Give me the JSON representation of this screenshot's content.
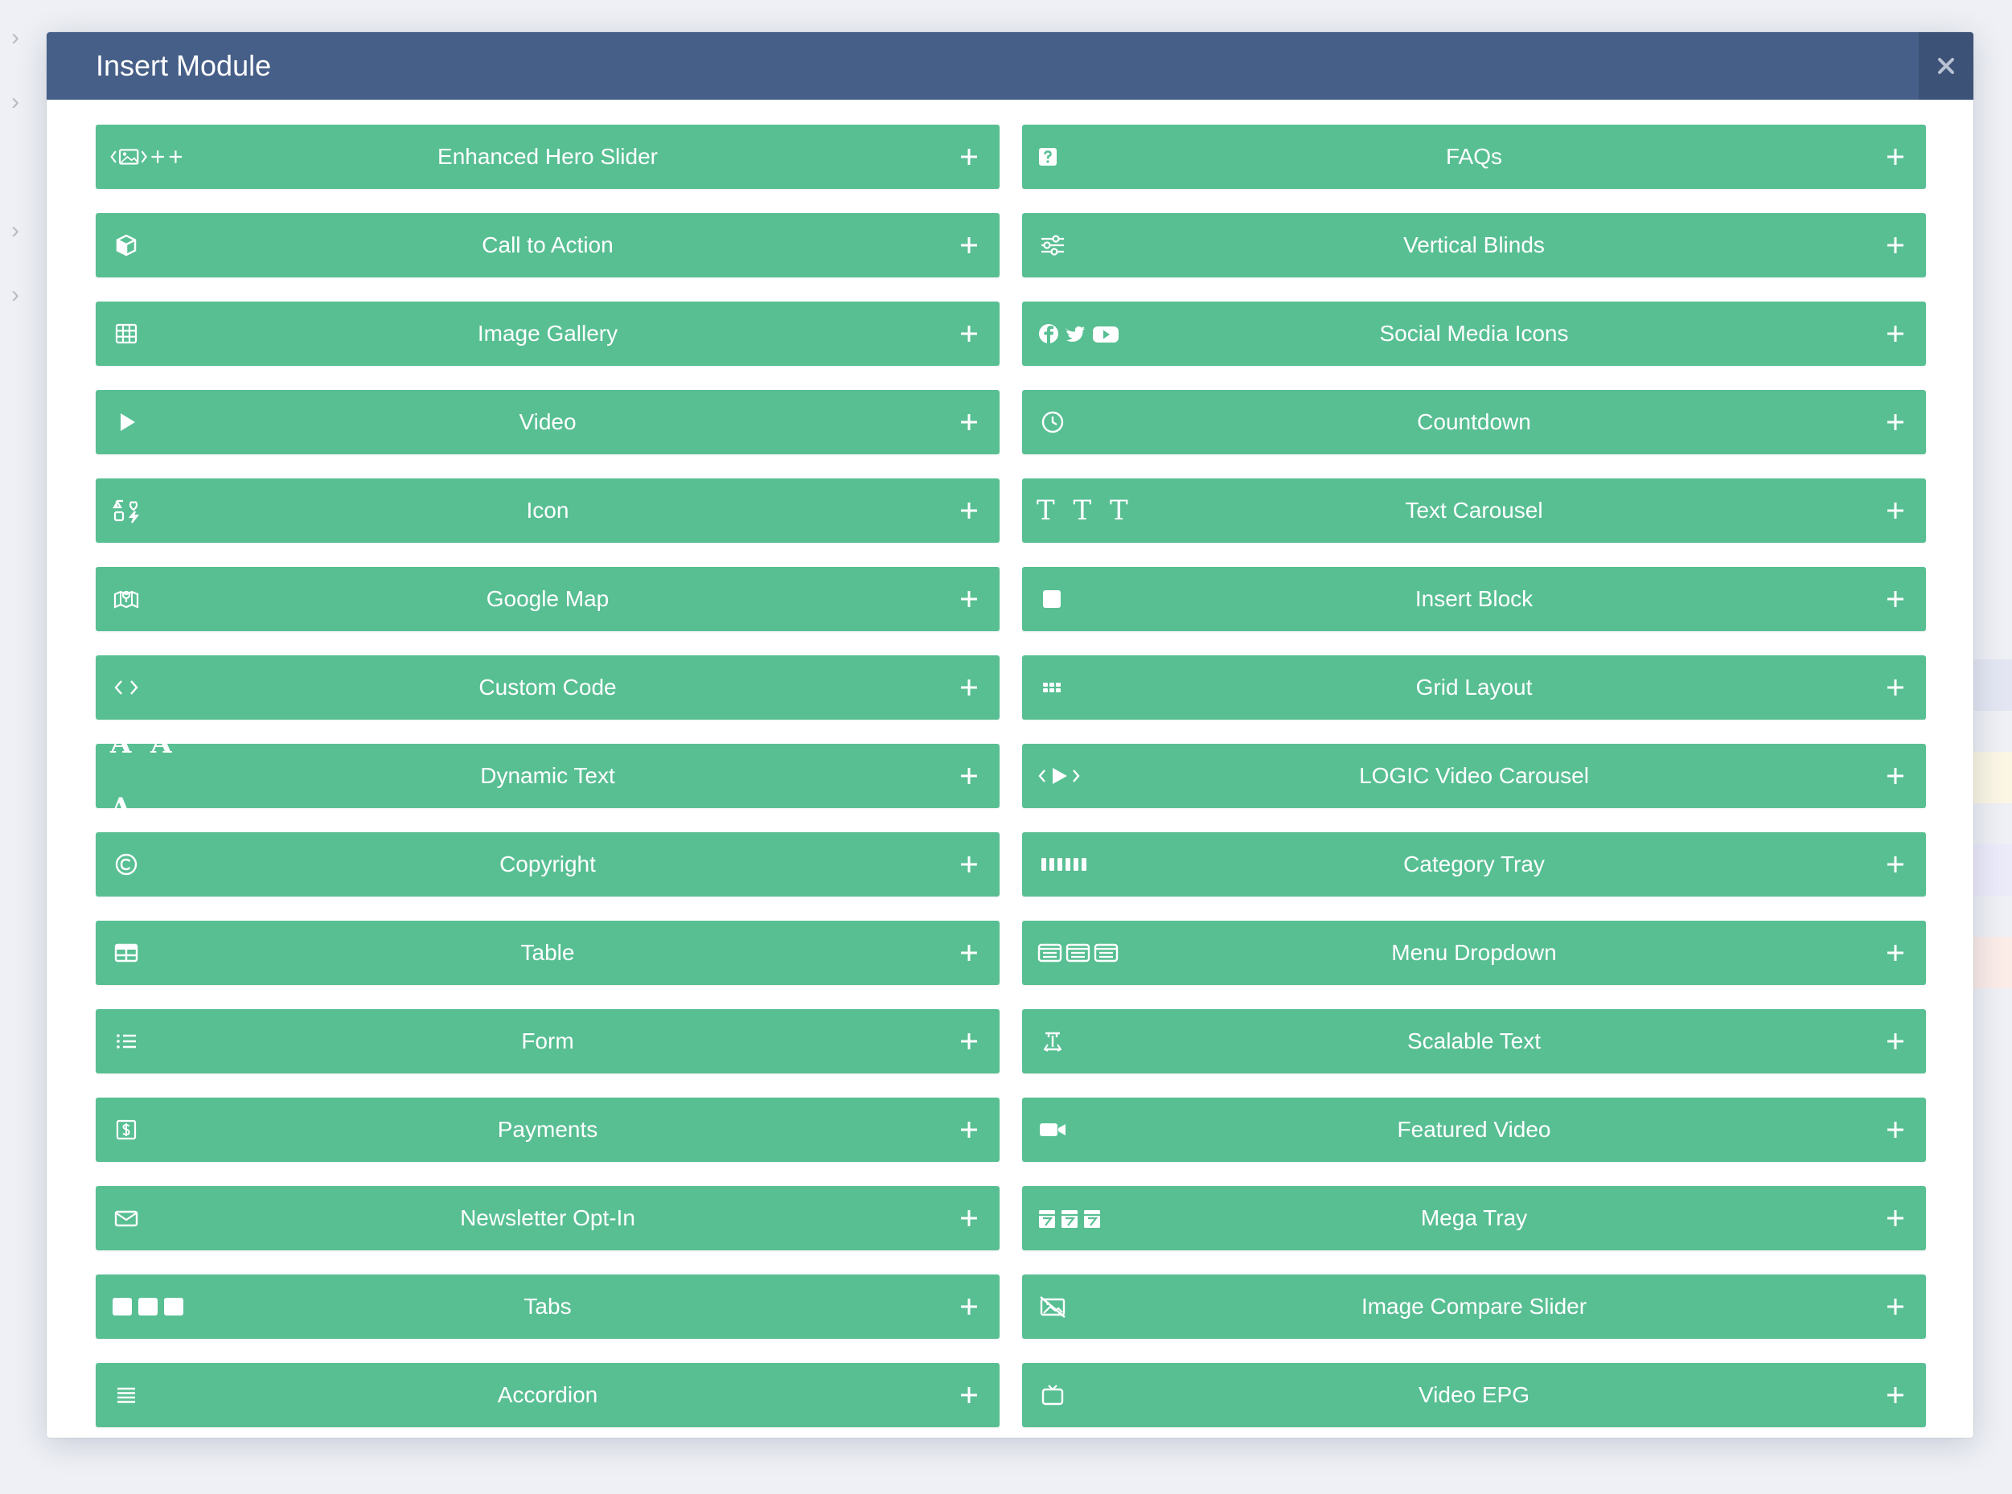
{
  "modal": {
    "title": "Insert Module",
    "close_icon": "close-icon"
  },
  "colors": {
    "header": "#465f88",
    "button": "#58bf93",
    "text": "#ffffff"
  },
  "left_column": [
    {
      "label": "Enhanced Hero Slider",
      "icon": "hero-slider-icon"
    },
    {
      "label": "Call to Action",
      "icon": "cube-icon"
    },
    {
      "label": "Image Gallery",
      "icon": "grid-table-icon"
    },
    {
      "label": "Video",
      "icon": "play-icon"
    },
    {
      "label": "Icon",
      "icon": "shapes-icon"
    },
    {
      "label": "Google Map",
      "icon": "map-icon"
    },
    {
      "label": "Custom Code",
      "icon": "code-icon"
    },
    {
      "label": "Dynamic Text",
      "icon": "triple-a-icon",
      "glyph": "A A A"
    },
    {
      "label": "Copyright",
      "icon": "copyright-icon"
    },
    {
      "label": "Table",
      "icon": "table-icon"
    },
    {
      "label": "Form",
      "icon": "list-icon"
    },
    {
      "label": "Payments",
      "icon": "dollar-icon"
    },
    {
      "label": "Newsletter Opt-In",
      "icon": "envelope-icon"
    },
    {
      "label": "Tabs",
      "icon": "tabs-icon"
    },
    {
      "label": "Accordion",
      "icon": "lines-icon"
    }
  ],
  "right_column": [
    {
      "label": "FAQs",
      "icon": "question-icon"
    },
    {
      "label": "Vertical Blinds",
      "icon": "sliders-icon"
    },
    {
      "label": "Social Media Icons",
      "icon": "social-icon"
    },
    {
      "label": "Countdown",
      "icon": "clock-icon"
    },
    {
      "label": "Text Carousel",
      "icon": "triple-t-icon",
      "glyph": "T T T"
    },
    {
      "label": "Insert Block",
      "icon": "square-icon"
    },
    {
      "label": "Grid Layout",
      "icon": "dots-grid-icon"
    },
    {
      "label": "LOGIC Video Carousel",
      "icon": "video-carousel-icon"
    },
    {
      "label": "Category Tray",
      "icon": "bars-icon"
    },
    {
      "label": "Menu Dropdown",
      "icon": "menu-cards-icon"
    },
    {
      "label": "Scalable Text",
      "icon": "scale-text-icon"
    },
    {
      "label": "Featured Video",
      "icon": "video-camera-icon"
    },
    {
      "label": "Mega Tray",
      "icon": "mega-tray-icon"
    },
    {
      "label": "Image Compare Slider",
      "icon": "image-slash-icon"
    },
    {
      "label": "Video EPG",
      "icon": "tv-icon"
    }
  ],
  "add_icon": "plus-icon"
}
